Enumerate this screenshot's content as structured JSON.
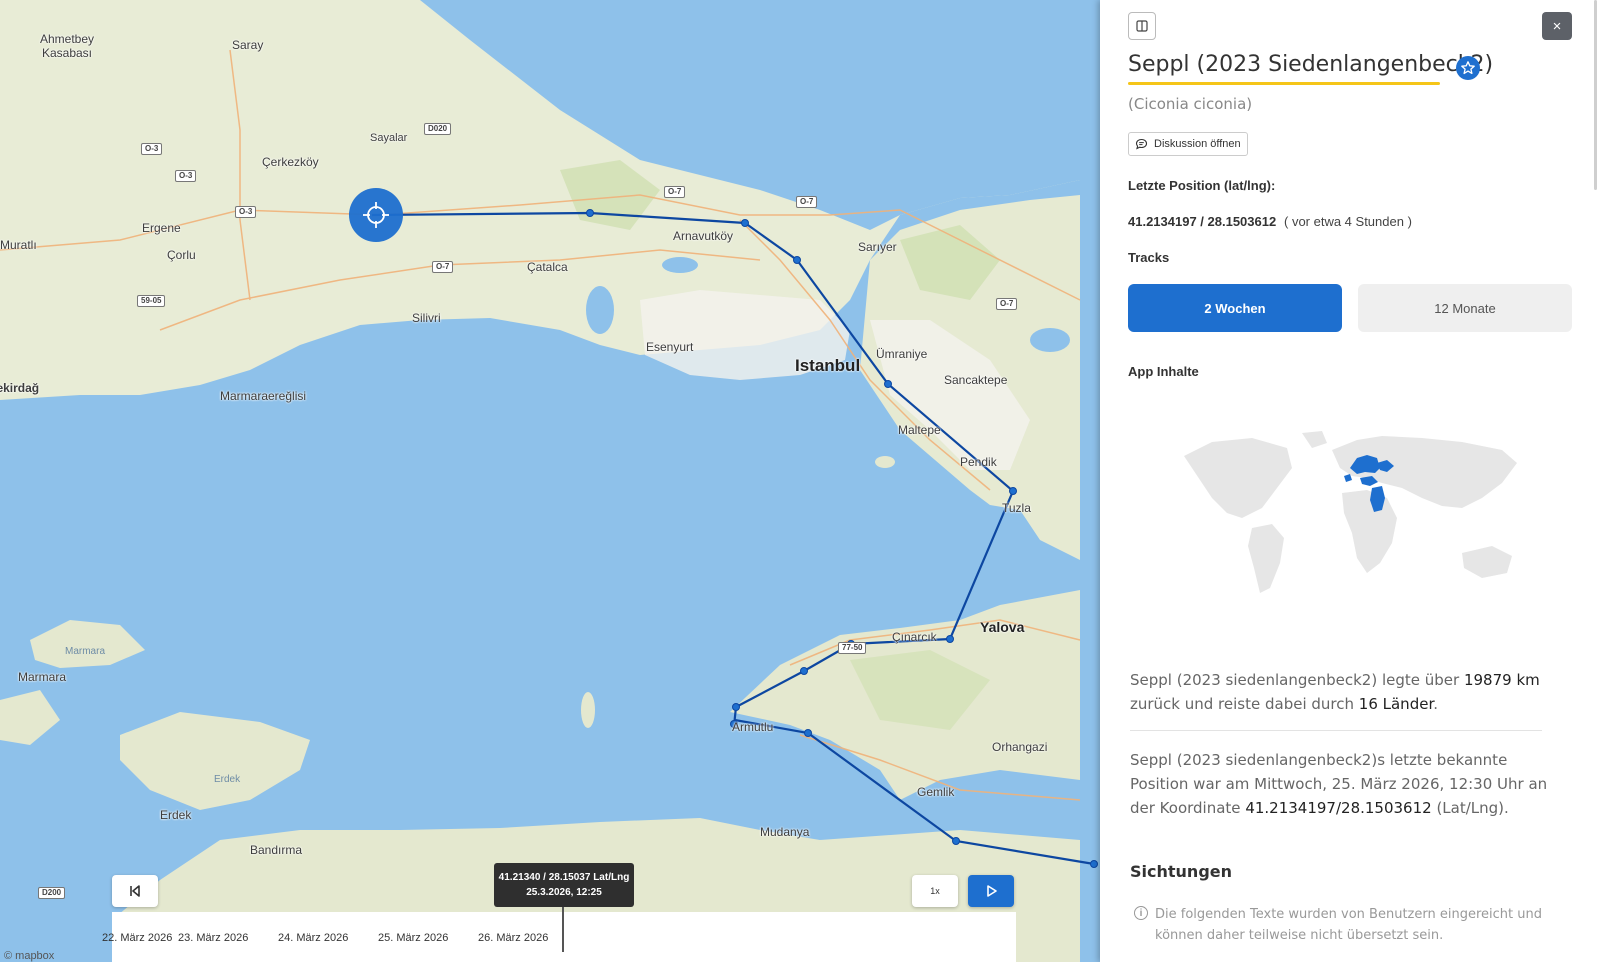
{
  "map": {
    "places": [
      {
        "name": "Ahmetbey Kasabası",
        "cls": ""
      },
      {
        "name": "Saray",
        "cls": ""
      },
      {
        "name": "Sayalar",
        "cls": ""
      },
      {
        "name": "Çerkezköy",
        "cls": ""
      },
      {
        "name": "Ergene",
        "cls": ""
      },
      {
        "name": "Çorlu",
        "cls": ""
      },
      {
        "name": "Muratlı",
        "cls": ""
      },
      {
        "name": "Arnavutköy",
        "cls": ""
      },
      {
        "name": "Sarıyer",
        "cls": ""
      },
      {
        "name": "Çatalca",
        "cls": ""
      },
      {
        "name": "Silivri",
        "cls": ""
      },
      {
        "name": "Esenyurt",
        "cls": ""
      },
      {
        "name": "Istanbul",
        "cls": "big"
      },
      {
        "name": "Ümraniye",
        "cls": ""
      },
      {
        "name": "Sancaktepe",
        "cls": ""
      },
      {
        "name": "Maltepe",
        "cls": ""
      },
      {
        "name": "Pendik",
        "cls": ""
      },
      {
        "name": "Tuzla",
        "cls": ""
      },
      {
        "name": "Tekirdağ",
        "cls": ""
      },
      {
        "name": "Marmaraereğlisi",
        "cls": ""
      },
      {
        "name": "Marmara",
        "cls": "sea"
      },
      {
        "name": "Marmara",
        "cls": ""
      },
      {
        "name": "Çınarcık",
        "cls": ""
      },
      {
        "name": "Yalova",
        "cls": "big"
      },
      {
        "name": "Armutlu",
        "cls": ""
      },
      {
        "name": "Orhangazi",
        "cls": ""
      },
      {
        "name": "Erdek",
        "cls": "sea"
      },
      {
        "name": "Erdek",
        "cls": ""
      },
      {
        "name": "Gemlik",
        "cls": ""
      },
      {
        "name": "Bandırma",
        "cls": ""
      },
      {
        "name": "Mudanya",
        "cls": ""
      }
    ],
    "shields": [
      "D020",
      "O-3",
      "O-3",
      "O-3",
      "O-7",
      "O-7",
      "59-05",
      "O-7",
      "O-7",
      "77-50",
      "D200"
    ],
    "attribution": "© mapbox",
    "track_icon": "bird-track-line"
  },
  "timeline": {
    "ticks": [
      "22. März 2026",
      "23. März 2026",
      "24. März 2026",
      "25. März 2026",
      "26. März 2026"
    ],
    "tooltip_coords": "41.21340 / 28.15037 Lat/Lng",
    "tooltip_time": "25.3.2026, 12:25",
    "speed_label": "1x",
    "skip_back_icon": "skip-back-icon",
    "play_icon": "play-icon"
  },
  "panel": {
    "title": "Seppl (2023 Siedenlangenbeck2)",
    "species": "(Ciconia ciconia)",
    "discuss_label": "Diskussion öffnen",
    "last_position_label": "Letzte Position (lat/lng):",
    "last_position_value": "41.2134197 / 28.1503612",
    "last_position_ago": "( vor etwa 4 Stunden )",
    "tracks_label": "Tracks",
    "tabs": [
      {
        "label": "2 Wochen",
        "active": true
      },
      {
        "label": "12 Monate",
        "active": false
      }
    ],
    "app_content_label": "App Inhalte",
    "summary_pre": "Seppl (2023 siedenlangenbeck2) legte über ",
    "summary_distance": "19879 km",
    "summary_mid": " zurück und reiste dabei durch ",
    "summary_countries": "16 Länder",
    "summary_end": ".",
    "lastpos_pre": "Seppl (2023 siedenlangenbeck2)s letzte bekannte Position war am Mittwoch, 25. März 2026, 12:30 Uhr an der Koordinate ",
    "lastpos_coords": "41.2134197/28.1503612",
    "lastpos_end": " (Lat/Lng).",
    "sightings_label": "Sichtungen",
    "info_text": "Die folgenden Texte wurden von Benutzern eingereicht und können daher teilweise nicht übersetzt sein.",
    "colors": {
      "accent": "#1e6fcf",
      "highlight": "#f5c518",
      "track": "#0d47a1"
    }
  }
}
